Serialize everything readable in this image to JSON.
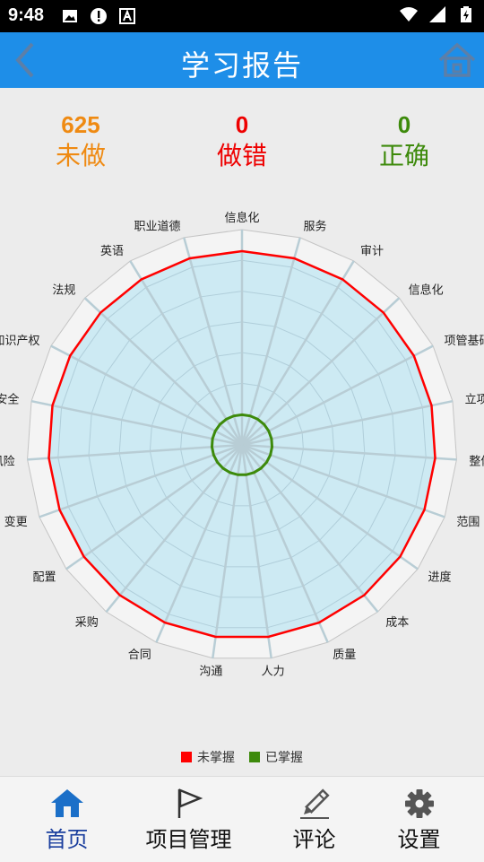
{
  "status_bar": {
    "time": "9:48",
    "left_icons": [
      "image-icon",
      "alert-icon",
      "a-badge-icon"
    ],
    "right_icons": [
      "wifi-icon",
      "signal-icon",
      "battery-icon"
    ]
  },
  "app_bar": {
    "title": "学习报告",
    "back_icon": "back-chevron-icon",
    "home_icon": "home-icon"
  },
  "stats": {
    "undone": {
      "value": "625",
      "label": "未做",
      "color": "#ef8a12"
    },
    "wrong": {
      "value": "0",
      "label": "做错",
      "color": "#ee0000"
    },
    "correct": {
      "value": "0",
      "label": "正确",
      "color": "#3d8a0b"
    }
  },
  "chart_data": {
    "type": "radar",
    "categories": [
      "信息化",
      "服务",
      "审计",
      "信息化",
      "项管基础",
      "立项",
      "整体",
      "范围",
      "进度",
      "成本",
      "质量",
      "人力",
      "沟通",
      "合同",
      "采购",
      "配置",
      "变更",
      "风险",
      "安全",
      "知识产权",
      "法规",
      "英语",
      "职业道德"
    ],
    "ylim": [
      0,
      100
    ],
    "grid": true,
    "legend_position": "bottom",
    "series": [
      {
        "name": "未掌握",
        "color": "#ff0000",
        "values": [
          90,
          90,
          90,
          90,
          90,
          90,
          90,
          90,
          90,
          90,
          90,
          90,
          90,
          90,
          90,
          90,
          90,
          90,
          90,
          90,
          90,
          90,
          90
        ]
      },
      {
        "name": "已掌握",
        "color": "#3d8a0b",
        "values": [
          14,
          14,
          14,
          14,
          14,
          14,
          14,
          14,
          14,
          14,
          14,
          14,
          14,
          14,
          14,
          14,
          14,
          14,
          14,
          14,
          14,
          14,
          14
        ]
      }
    ]
  },
  "bottom_nav": [
    {
      "label": "首页",
      "icon": "home-icon",
      "active": true
    },
    {
      "label": "项目管理",
      "icon": "flag-icon",
      "active": false
    },
    {
      "label": "评论",
      "icon": "pencil-edit-icon",
      "active": false
    },
    {
      "label": "设置",
      "icon": "gear-icon",
      "active": false
    }
  ],
  "colors": {
    "app_bar": "#1e8ee8",
    "radar_fill": "#cdeaf3",
    "nav_active": "#1b3f9e"
  }
}
